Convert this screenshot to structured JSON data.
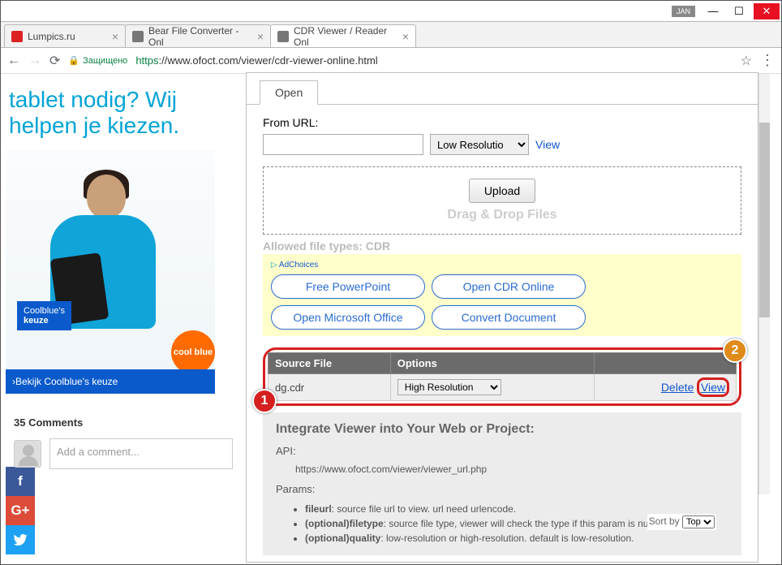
{
  "window": {
    "lang": "JAN"
  },
  "tabs": [
    {
      "title": "Lumpics.ru",
      "fav": "#d22"
    },
    {
      "title": "Bear File Converter - Onl",
      "fav": "#888"
    },
    {
      "title": "CDR Viewer / Reader Onl",
      "fav": "#888"
    }
  ],
  "address": {
    "secure": "Защищено",
    "proto": "https",
    "url": "://www.ofoct.com/viewer/cdr-viewer-online.html"
  },
  "ad": {
    "headline": "tablet nodig? Wij helpen je kiezen.",
    "keuze_top": "Coolblue's",
    "keuze": "keuze",
    "cool": "cool blue",
    "footer": "Bekijk Coolblue's keuze"
  },
  "comments": {
    "count": "35 Comments",
    "placeholder": "Add a comment..."
  },
  "panel": {
    "tab": "Open",
    "from_url": "From URL:",
    "res": "Low Resolutio",
    "view": "View",
    "upload": "Upload",
    "dd": "Drag & Drop Files",
    "allowed": "Allowed file types: CDR",
    "adc": "AdChoices",
    "ad_btns": [
      "Free PowerPoint",
      "Open CDR Online",
      "Open Microsoft Office",
      "Convert Document"
    ],
    "table": {
      "h1": "Source File",
      "h2": "Options",
      "file": "dg.cdr",
      "opt": "High Resolution",
      "del": "Delete",
      "view": "View"
    },
    "integrate": {
      "title": "Integrate Viewer into Your Web or Project:",
      "api": "API:",
      "apiurl": "https://www.ofoct.com/viewer/viewer_url.php",
      "params": "Params:",
      "li1a": "fileurl",
      "li1b": ": source file url to view. url need urlencode.",
      "li2a": "(optional)filetype",
      "li2b": ": source file type, viewer will check the type if this param is null.",
      "li3a": "(optional)quality",
      "li3b": ": low-resolution or high-resolution. default is low-resolution."
    },
    "sortby": "Sort by",
    "sortopt": "Top"
  },
  "callouts": {
    "c1": "1",
    "c2": "2"
  }
}
